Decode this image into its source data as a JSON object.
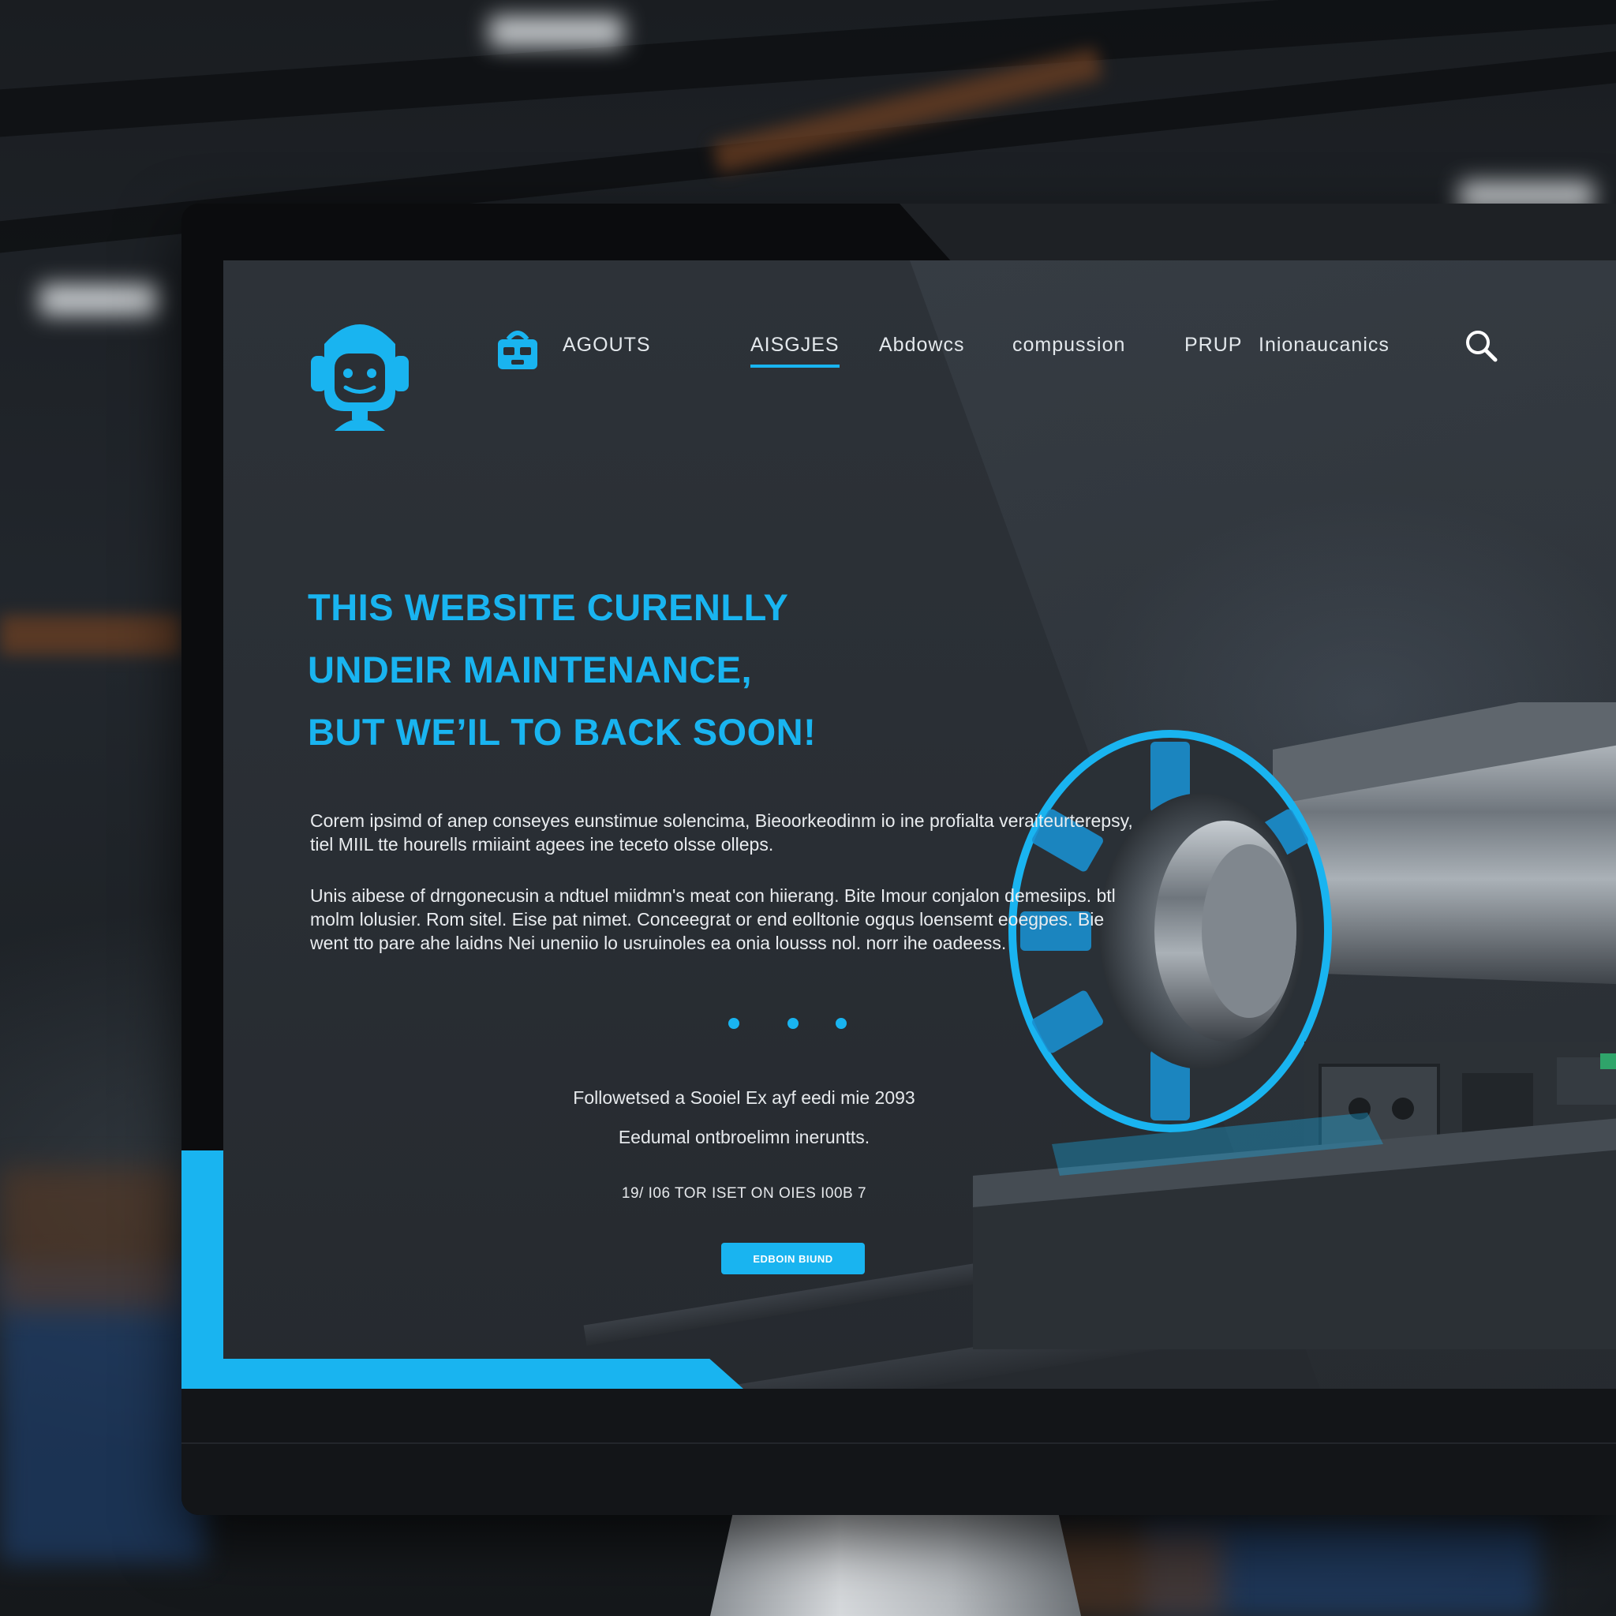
{
  "brand": {
    "accent_color": "#19b4f0",
    "logo_icon": "robot-head-icon"
  },
  "nav": {
    "icon": "toolbox-icon",
    "items": [
      {
        "label": "AGOUTS",
        "active": false
      },
      {
        "label": "AISGJES",
        "active": true
      },
      {
        "label": "Abdowcs",
        "active": false
      },
      {
        "label": "compussion",
        "active": false
      },
      {
        "label": "PRUP",
        "active": false
      },
      {
        "label": "Inionaucanics",
        "active": false
      }
    ],
    "search_icon": "search-icon"
  },
  "hero": {
    "headline_lines": [
      "THIS WEBSITE CURENLLY",
      "UNDEIR MAINTENANCE,",
      "BUT WE’IL TO BACK SOON!"
    ],
    "paragraph_1": "Corem ipsimd of anep conseyes eunstimue solencima, Bieoorkeodinm io ine profialta veraiteurterepsy, tiel MIIL tte hourells rmiiaint agees ine teceto olsse olleps.",
    "paragraph_2": "Unis aibese of drngonecusin a ndtuel miidmn's meat con hiierang. Bite Imour conjalon demesiips. btl molm lolusier. Rom sitel. Eise pat nimet. Conceegrat or end eolltonie ogqus loensemt eoegpes. Bie went tto pare ahe laidns Nei uneniio lo usruinoles ea onia lousss nol. norr ihe oadeess.",
    "carousel_dots": 3,
    "footer_line_1": "Followetsed a Sooiel Ex ayf eedi mie 2093",
    "footer_line_2": "Eedumal ontbroelimn ineruntts.",
    "footer_line_3": "19/ I06 TOR ISET ON OIES I00B 7",
    "cta_label": "EDBOIN BIUND"
  }
}
